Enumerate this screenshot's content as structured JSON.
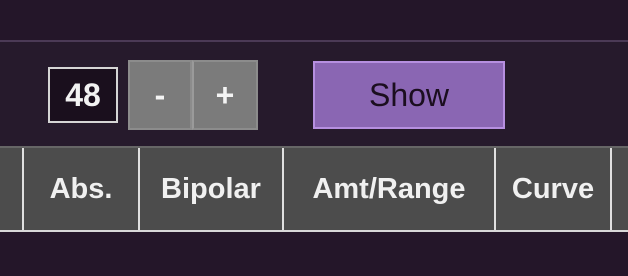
{
  "controls": {
    "number_value": "48",
    "decrement_label": "-",
    "increment_label": "+",
    "show_label": "Show"
  },
  "table": {
    "columns": [
      "Abs.",
      "Bipolar",
      "Amt/Range",
      "Curve"
    ]
  },
  "colors": {
    "background": "#241629",
    "show_button": "#8a66b3",
    "step_button": "#7b7b7b",
    "header_row": "#4c4c4c"
  }
}
